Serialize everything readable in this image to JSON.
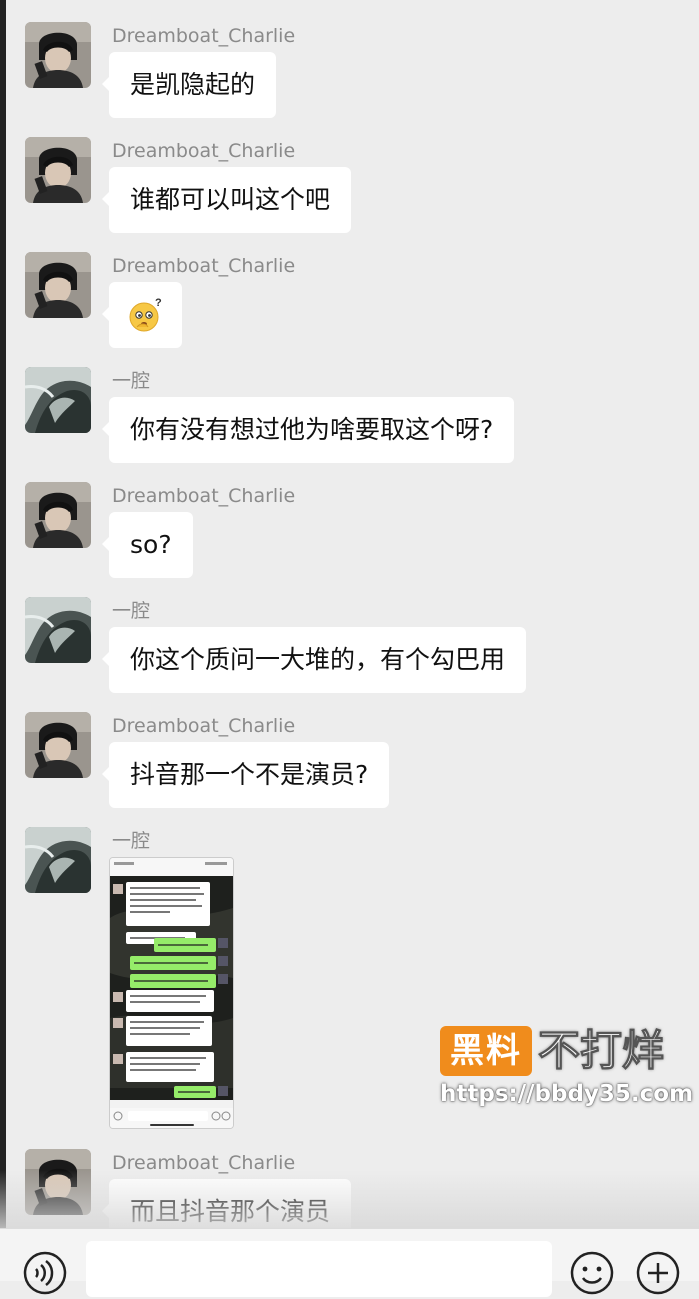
{
  "messages": [
    {
      "sender": "Dreamboat_Charlie",
      "text": "是凯隐起的"
    },
    {
      "sender": "Dreamboat_Charlie",
      "text": "谁都可以叫这个吧"
    },
    {
      "sender": "Dreamboat_Charlie",
      "emoji": "thinking-question-emoji"
    },
    {
      "sender": "一腔",
      "text": "你有没有想过他为啥要取这个呀?"
    },
    {
      "sender": "Dreamboat_Charlie",
      "text": "so?"
    },
    {
      "sender": "一腔",
      "text": "你这个质问一大堆的，有个勾巴用"
    },
    {
      "sender": "Dreamboat_Charlie",
      "text": "抖音那一个不是演员?"
    },
    {
      "sender": "一腔",
      "image": "chat-screenshot-thumbnail"
    },
    {
      "sender": "Dreamboat_Charlie",
      "text": "而且抖音那个演员"
    }
  ],
  "input_bar": {
    "icons": [
      "voice-icon",
      "emoji-icon",
      "plus-icon"
    ]
  },
  "watermark": {
    "badge": "黑料",
    "title": "不打烊",
    "url": "https://bbdy35.com"
  },
  "colors": {
    "background": "#ededed",
    "bubble": "#ffffff",
    "sender_name": "#8a8a8a",
    "watermark_orange": "#f08c1c"
  }
}
